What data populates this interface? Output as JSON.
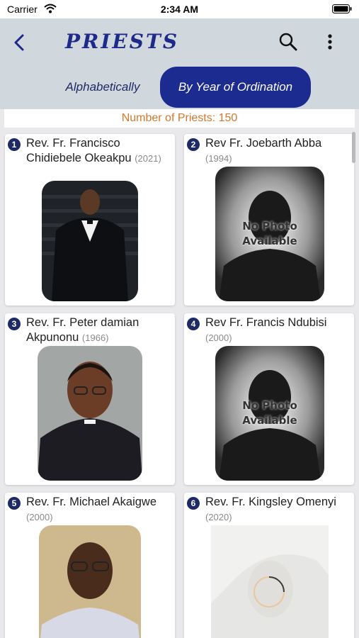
{
  "status_bar": {
    "carrier": "Carrier",
    "time": "2:34 AM"
  },
  "header": {
    "title": "PRIESTS"
  },
  "tabs": [
    {
      "label": "Alphabetically",
      "active": false
    },
    {
      "label": "By Year of Ordination",
      "active": true
    }
  ],
  "count_text": "Number of Priests: 150",
  "placeholder_photo": {
    "line1": "No Photo",
    "line2": "Available"
  },
  "priests": [
    {
      "num": "1",
      "name": "Rev. Fr. Francisco Chidiebele Okeakpu",
      "year": "(2021)",
      "photo": "portrait"
    },
    {
      "num": "2",
      "name": "Rev Fr. Joebarth Abba",
      "year": "(1994)",
      "photo": "no-photo"
    },
    {
      "num": "3",
      "name": "Rev. Fr. Peter damian Akpunonu",
      "year": "(1966)",
      "photo": "portrait"
    },
    {
      "num": "4",
      "name": "Rev Fr. Francis Ndubisi",
      "year": "(2000)",
      "photo": "no-photo"
    },
    {
      "num": "5",
      "name": "Rev. Fr. Michael Akaigwe",
      "year": "(2000)",
      "photo": "portrait"
    },
    {
      "num": "6",
      "name": "Rev. Fr. Kingsley Omenyi",
      "year": "(2020)",
      "photo": "loading"
    }
  ],
  "colors": {
    "accent": "#1c2b8f",
    "count_text": "#d2782a",
    "header_bg": "#d0d7dd"
  }
}
